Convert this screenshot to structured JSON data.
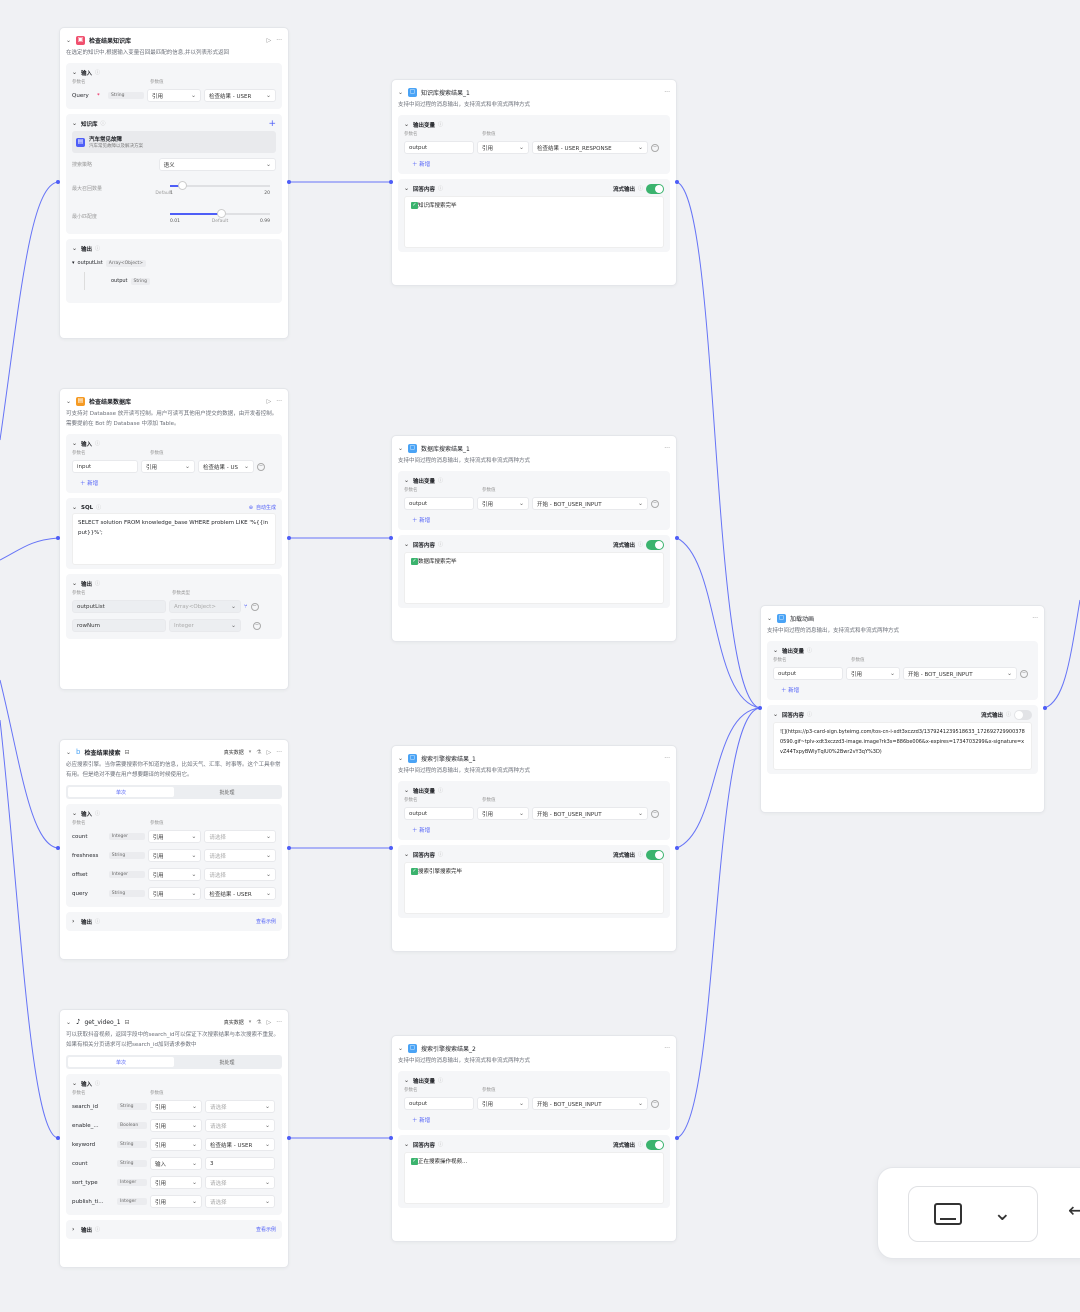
{
  "colors": {
    "accent": "#4e5ef7",
    "toggle_on": "#3bb36e",
    "kb_icon": "#f0506e",
    "db_icon": "#f59a23",
    "msg_icon": "#4aa3f5"
  },
  "common": {
    "label_name": "参数名",
    "label_value": "参数值",
    "label_type": "参数类型",
    "input": "输入",
    "output": "输出",
    "ref": "引用",
    "add": "新增",
    "out_var": "输出变量",
    "answer": "回答内容",
    "stream": "流式输出",
    "placeholder": "请选择",
    "single": "单次",
    "batch": "批处理",
    "example": "查看示例",
    "real_data": "真实数据",
    "msg_desc": "支持中间过程的消息输出，支持流式和非流式两种方式"
  },
  "kb": {
    "title": "检查结果知识库",
    "desc": "在选定的知识中,根据输入变量召回最匹配的信息,并以列表形式返回",
    "query_name": "Query",
    "query_type": "String",
    "query_ref": "检查结果 - USER",
    "kb_label": "知识库",
    "kb_item_title": "汽车常见故障",
    "kb_item_sub": "汽车常见故障以及解决方案",
    "strategy_label": "搜索策略",
    "strategy_value": "语义",
    "max_label": "最大召回数量",
    "max_min": "1",
    "max_default": "Default",
    "max_max": "20",
    "min_label": "最小匹配度",
    "min_min": "0.01",
    "min_default": "Default",
    "min_max": "0.99",
    "out_list": "outputList",
    "out_list_type": "Array<Object>",
    "out_item": "output",
    "out_item_type": "String"
  },
  "db": {
    "title": "检查结果数据库",
    "desc": "可支持对 Database 放开读写控制。用户可读写其他用户提交的数据，由开发者控制。需要提前在 Bot 的 Database 中添加 Table。",
    "in_name": "input",
    "in_ref": "检查结果 - US",
    "sql_label": "SQL",
    "auto_gen": "自动生成",
    "sql_text": "SELECT solution FROM knowledge_base WHERE problem LIKE '%{{input}}%';",
    "out1": "outputList",
    "out1_type": "Array<Object>",
    "out2": "rowNum",
    "out2_type": "Integer"
  },
  "search": {
    "title": "检查结果搜索",
    "desc": "必应搜索引擎。当你需要搜索你不知道的信息，比如天气、汇率、时事等。这个工具非常有用。但是绝对不要在用户想要翻译的时候使用它。",
    "params": [
      {
        "name": "count",
        "type": "Integer",
        "ref": "引用",
        "value": "请选择"
      },
      {
        "name": "freshness",
        "type": "String",
        "ref": "引用",
        "value": "请选择"
      },
      {
        "name": "offset",
        "type": "Integer",
        "ref": "引用",
        "value": "请选择"
      },
      {
        "name": "query",
        "type": "String",
        "ref": "引用",
        "value": "检查结果 - USER"
      }
    ]
  },
  "video": {
    "title": "get_video_1",
    "desc": "可以获取抖音视频，返回字段中的search_id可以保证下次搜索结果与本次搜索不重复。如果有相关分页请求可以把search_id加到请求参数中",
    "params": [
      {
        "name": "search_id",
        "type": "String",
        "ref": "引用",
        "value": "请选择"
      },
      {
        "name": "enable_...",
        "type": "Boolean",
        "ref": "引用",
        "value": "请选择"
      },
      {
        "name": "keyword",
        "type": "String",
        "ref": "引用",
        "value": "检查结果 - USER"
      },
      {
        "name": "count",
        "type": "String",
        "ref": "输入",
        "value": "3"
      },
      {
        "name": "sort_type",
        "type": "Integer",
        "ref": "引用",
        "value": "请选择"
      },
      {
        "name": "publish_ti...",
        "type": "Integer",
        "ref": "引用",
        "value": "请选择"
      }
    ]
  },
  "msgs": [
    {
      "title": "知识库搜索结果_1",
      "var": "output",
      "ref": "引用",
      "src": "检查结果 - USER_RESPONSE",
      "answer": "知识库搜索完毕"
    },
    {
      "title": "数据库搜索结果_1",
      "var": "output",
      "ref": "引用",
      "src": "开始 - BOT_USER_INPUT",
      "answer": "数据库搜索完毕"
    },
    {
      "title": "搜索引擎搜索结果_1",
      "var": "output",
      "ref": "引用",
      "src": "开始 - BOT_USER_INPUT",
      "answer": "搜索引擎搜索完毕"
    },
    {
      "title": "搜索引擎搜索结果_2",
      "var": "output",
      "ref": "引用",
      "src": "开始 - BOT_USER_INPUT",
      "answer": "正在搜索操作视频..."
    }
  ],
  "loading": {
    "title": "加载动画",
    "var": "output",
    "ref": "引用",
    "src": "开始 - BOT_USER_INPUT",
    "answer": "![](https://p3-card-sign.byteimg.com/tos-cn-i-xdt3xczzd3/1379241239518633_1726927299003780590.gif~tplv-xdt3xczzd3-image.image?rk3s=886be006&x-expires=1734703299&x-signature=xvZ44TxpyBWlyTqlU0%2Bwr2vY3qY%3D)"
  }
}
